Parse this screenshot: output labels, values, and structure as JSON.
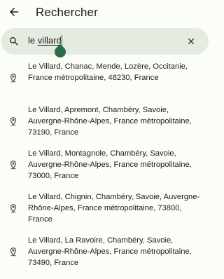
{
  "header": {
    "title": "Rechercher",
    "back_icon": "arrow-left-icon"
  },
  "search": {
    "prefix": "le ",
    "underlined": "villard",
    "clear_icon": "close-icon"
  },
  "results": [
    "Le Villard, Chanac, Mende, Lozère, Occitanie, France métropolitaine, 48230, France",
    "Le Villard, Apremont, Chambéry, Savoie, Auvergne-Rhône-Alpes, France métropolitaine, 73190, France",
    "Le Villard, Montagnole, Chambéry, Savoie, Auvergne-Rhône-Alpes, France métropolitaine, 73000, France",
    "Le Villard, Chignin, Chambéry, Savoie, Auvergne-Rhône-Alpes, France métropolitaine, 73800, France",
    "Le Villard, La Ravoire, Chambéry, Savoie, Auvergne-Rhône-Alpes, France métropolitaine, 73490, France"
  ],
  "colors": {
    "accent": "#2f6b4a",
    "field_bg": "#e6ebe2",
    "background": "#fbfdf7"
  }
}
